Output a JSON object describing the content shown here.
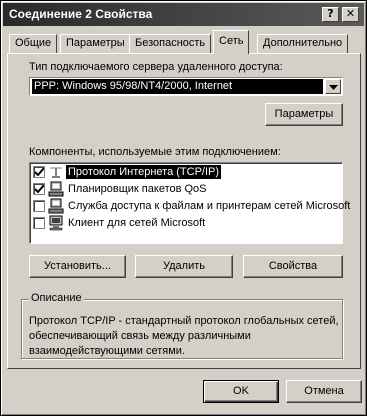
{
  "window": {
    "title": "Соединение 2 Свойства",
    "help_button": "?",
    "close_button": "✕"
  },
  "tabs": [
    {
      "label": "Общие"
    },
    {
      "label": "Параметры"
    },
    {
      "label": "Безопасность"
    },
    {
      "label": "Сеть",
      "active": true
    },
    {
      "label": "Дополнительно"
    }
  ],
  "server_type": {
    "label": "Тип подключаемого сервера удаленного доступа:",
    "value": "PPP: Windows 95/98/NT4/2000, Internet"
  },
  "params_button": "Параметры",
  "components": {
    "label": "Компоненты, используемые этим подключением:",
    "items": [
      {
        "label": "Протокол Интернета (TCP/IP)",
        "checked": true,
        "icon": "network-protocol-icon",
        "selected": true
      },
      {
        "label": "Планировщик пакетов QoS",
        "checked": true,
        "icon": "network-service-icon"
      },
      {
        "label": "Служба доступа к файлам и принтерам сетей Microsoft",
        "checked": false,
        "icon": "network-service-icon"
      },
      {
        "label": "Клиент для сетей Microsoft",
        "checked": false,
        "icon": "network-client-icon"
      }
    ]
  },
  "buttons": {
    "install": "Установить...",
    "remove": "Удалить",
    "properties": "Свойства",
    "ok": "OK",
    "cancel": "Отмена"
  },
  "description": {
    "title": "Описание",
    "text": "Протокол TCP/IP - стандартный протокол глобальных сетей, обеспечивающий связь между различными взаимодействующими сетями."
  },
  "colors": {
    "dialog_bg": "#d4d0c8",
    "selection": "#000000"
  }
}
